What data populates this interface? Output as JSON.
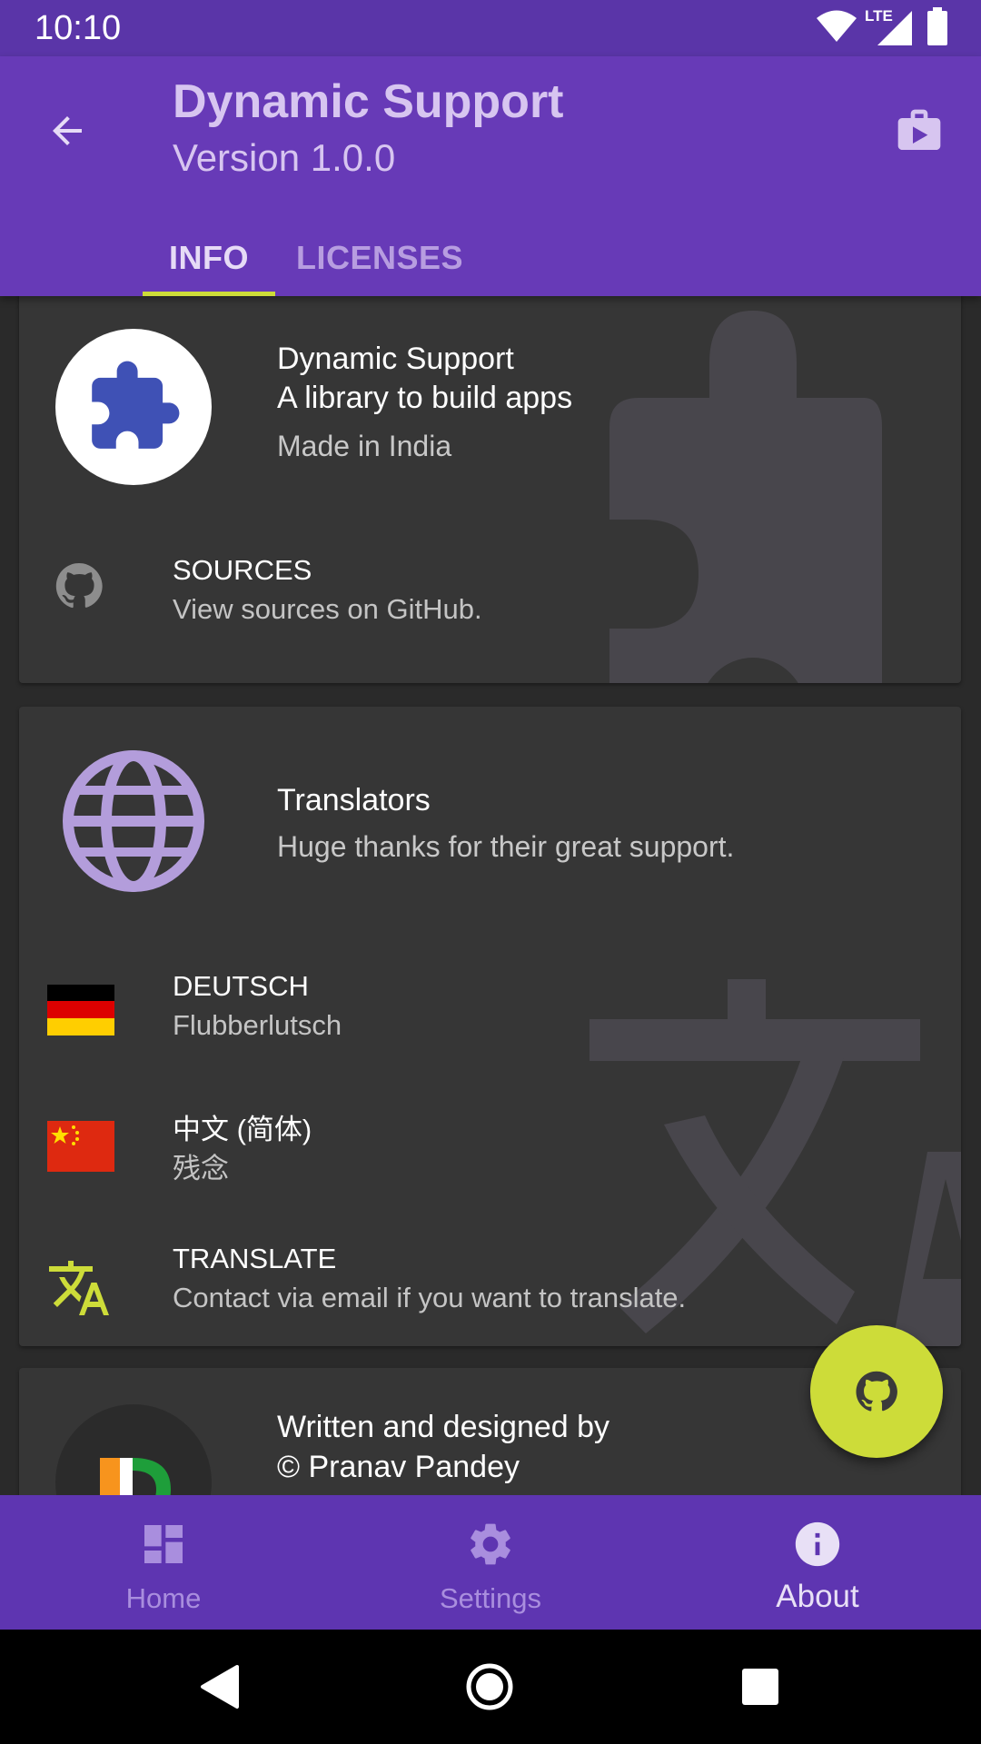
{
  "status_bar": {
    "time": "10:10",
    "network": "LTE",
    "icons": [
      "wifi-icon",
      "cell-signal-icon",
      "battery-icon"
    ]
  },
  "app_bar": {
    "title": "Dynamic Support",
    "subtitle": "Version 1.0.0",
    "tabs": [
      {
        "label": "INFO",
        "active": true
      },
      {
        "label": "LICENSES",
        "active": false
      }
    ]
  },
  "app_card": {
    "name": "Dynamic Support",
    "description": "A library to build apps",
    "origin": "Made in India",
    "sources": {
      "title": "SOURCES",
      "subtitle": "View sources on GitHub."
    }
  },
  "translators_card": {
    "title": "Translators",
    "subtitle": "Huge thanks for their great support.",
    "items": [
      {
        "title": "DEUTSCH",
        "subtitle": "Flubberlutsch",
        "icon": "germany-flag-icon"
      },
      {
        "title": "中文 (简体)",
        "subtitle": "残念",
        "icon": "china-flag-icon"
      },
      {
        "title": "TRANSLATE",
        "subtitle": "Contact via email if you want to translate.",
        "icon": "translate-icon"
      }
    ]
  },
  "author_card": {
    "title": "Written and designed by",
    "subtitle": "© Pranav Pandey"
  },
  "bottom_nav": {
    "items": [
      {
        "label": "Home",
        "icon": "dashboard-icon",
        "active": false
      },
      {
        "label": "Settings",
        "icon": "gear-icon",
        "active": false
      },
      {
        "label": "About",
        "icon": "info-icon",
        "active": true
      }
    ]
  },
  "colors": {
    "primary": "#673ab7",
    "primary_dark": "#5a35a8",
    "accent": "#cddc39",
    "surface": "#363636",
    "background": "#2a2a2a"
  }
}
